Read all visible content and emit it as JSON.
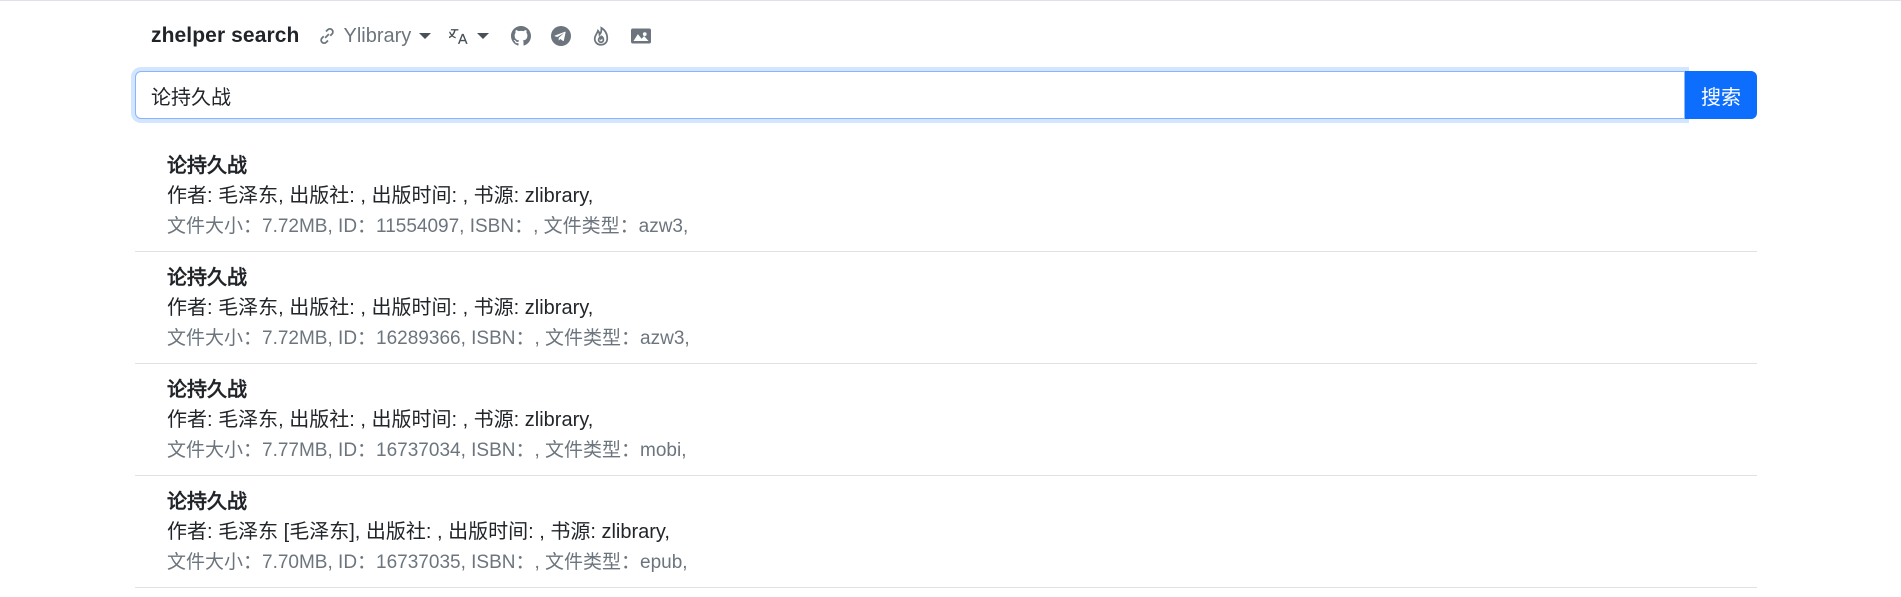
{
  "navbar": {
    "brand": "zhelper search",
    "source_selector": {
      "icon": "link-icon",
      "label": "Ylibrary"
    },
    "language_selector": {
      "icon": "translate-icon"
    },
    "icon_links": [
      "github-icon",
      "telegram-icon",
      "fire-icon",
      "image-icon"
    ]
  },
  "search": {
    "value": "论持久战",
    "button_label": "搜索"
  },
  "results": [
    {
      "title": "论持久战",
      "meta": "作者: 毛泽东, 出版社: , 出版时间: , 书源: zlibrary,",
      "info": "文件大小：7.72MB, ID：11554097, ISBN：, 文件类型：azw3,"
    },
    {
      "title": "论持久战",
      "meta": "作者: 毛泽东, 出版社: , 出版时间: , 书源: zlibrary,",
      "info": "文件大小：7.72MB, ID：16289366, ISBN：, 文件类型：azw3,"
    },
    {
      "title": "论持久战",
      "meta": "作者: 毛泽东, 出版社: , 出版时间: , 书源: zlibrary,",
      "info": "文件大小：7.77MB, ID：16737034, ISBN：, 文件类型：mobi,"
    },
    {
      "title": "论持久战",
      "meta": "作者: 毛泽东 [毛泽东], 出版社: , 出版时间: , 书源: zlibrary,",
      "info": "文件大小：7.70MB, ID：16737035, ISBN：, 文件类型：epub,"
    }
  ],
  "colors": {
    "primary": "#0d6efd",
    "muted_text": "#6c757d",
    "border": "#dee2e6"
  }
}
